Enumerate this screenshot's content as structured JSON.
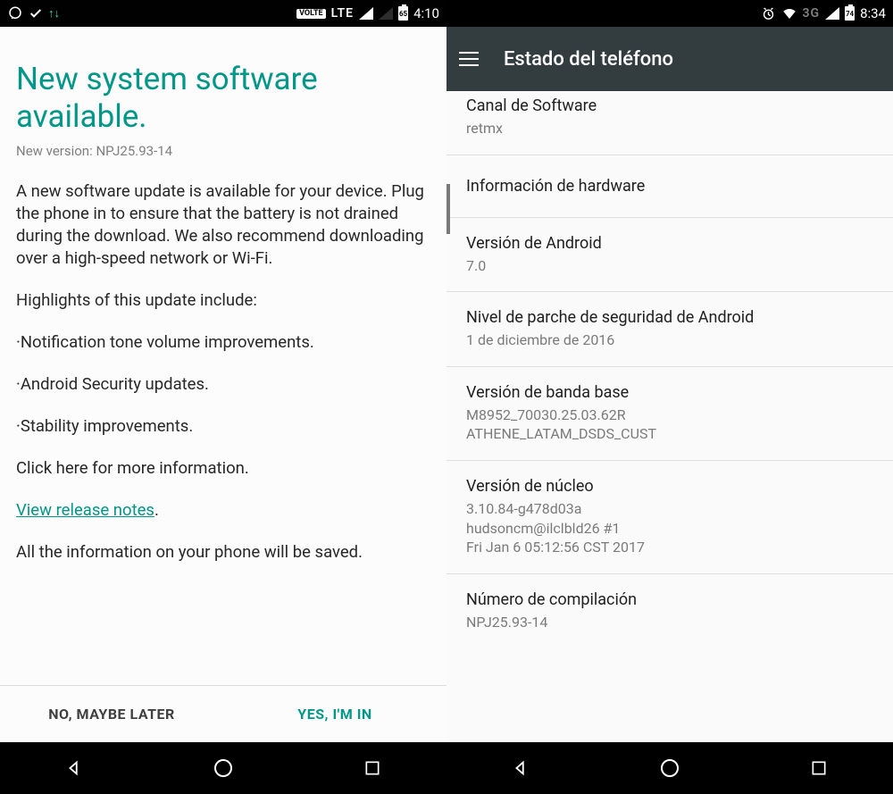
{
  "left": {
    "status": {
      "volte": "VOLTE",
      "network": "LTE",
      "battery": "65",
      "time": "4:10"
    },
    "title": "New system software available.",
    "version_prefix": "New version: ",
    "version": "NPJ25.93-14",
    "intro": "A new software update is available for your device. Plug the phone in to ensure that the battery is not drained during the download. We also recommend downloading over a high-speed network or Wi-Fi.",
    "highlights_heading": "Highlights of this update include:",
    "bullets": [
      "·Notification tone volume improvements.",
      "·Android Security updates.",
      "·Stability improvements."
    ],
    "more_info": "Click here for more information.",
    "release_link": "View release notes",
    "saved_line": "All the information on your phone will be saved.",
    "btn_no": "NO, MAYBE LATER",
    "btn_yes": "YES, I'M IN"
  },
  "right": {
    "status": {
      "network": "3G",
      "battery": "74",
      "time": "8:34"
    },
    "appbar_title": "Estado del teléfono",
    "items": [
      {
        "label": "Canal de Software",
        "value": "retmx"
      },
      {
        "label": "Información de hardware",
        "value": ""
      },
      {
        "label": "Versión de Android",
        "value": "7.0"
      },
      {
        "label": "Nivel de parche de seguridad de Android",
        "value": "1 de diciembre de 2016"
      },
      {
        "label": "Versión de banda base",
        "value": "M8952_70030.25.03.62R\nATHENE_LATAM_DSDS_CUST"
      },
      {
        "label": "Versión de núcleo",
        "value": "3.10.84-g478d03a\nhudsoncm@ilclbld26 #1\nFri Jan 6 05:12:56 CST 2017"
      },
      {
        "label": "Número de compilación",
        "value": "NPJ25.93-14"
      }
    ]
  }
}
